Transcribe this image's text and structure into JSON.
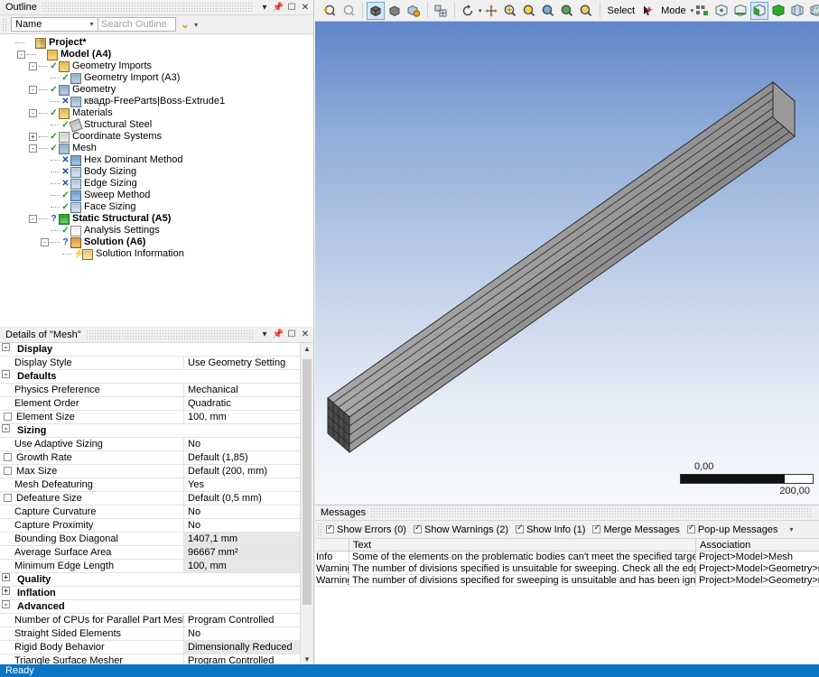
{
  "outline": {
    "title": "Outline",
    "title_buttons": [
      "dropdown-icon",
      "pin-icon",
      "maximize-icon",
      "close-icon"
    ],
    "filter_combo": "Name",
    "search_placeholder": "Search Outline",
    "tree": [
      {
        "label": "Project*",
        "indent": 0,
        "expander": "none",
        "status": "",
        "icon": "project-icon",
        "bold": true
      },
      {
        "label": "Model (A4)",
        "indent": 1,
        "expander": "-",
        "status": "",
        "icon": "model-icon",
        "bold": true
      },
      {
        "label": "Geometry Imports",
        "indent": 2,
        "expander": "-",
        "status": "ok",
        "icon": "geometry-imports-icon",
        "bold": false
      },
      {
        "label": "Geometry Import (A3)",
        "indent": 3,
        "expander": "none",
        "status": "ok",
        "icon": "geometry-import-icon",
        "bold": false
      },
      {
        "label": "Geometry",
        "indent": 2,
        "expander": "-",
        "status": "ok",
        "icon": "geometry-icon",
        "bold": false
      },
      {
        "label": "квадр-FreeParts|Boss-Extrude1",
        "indent": 3,
        "expander": "none",
        "status": "x",
        "icon": "body-icon",
        "bold": false
      },
      {
        "label": "Materials",
        "indent": 2,
        "expander": "-",
        "status": "ok",
        "icon": "materials-icon",
        "bold": false
      },
      {
        "label": "Structural Steel",
        "indent": 3,
        "expander": "none",
        "status": "ok",
        "icon": "material-icon",
        "bold": false
      },
      {
        "label": "Coordinate Systems",
        "indent": 2,
        "expander": "+",
        "status": "ok",
        "icon": "coordinate-systems-icon",
        "bold": false
      },
      {
        "label": "Mesh",
        "indent": 2,
        "expander": "-",
        "status": "ok",
        "icon": "mesh-icon",
        "bold": false
      },
      {
        "label": "Hex Dominant Method",
        "indent": 3,
        "expander": "none",
        "status": "x",
        "icon": "method-icon",
        "bold": false
      },
      {
        "label": "Body Sizing",
        "indent": 3,
        "expander": "none",
        "status": "x",
        "icon": "sizing-icon",
        "bold": false
      },
      {
        "label": "Edge Sizing",
        "indent": 3,
        "expander": "none",
        "status": "x",
        "icon": "sizing-icon",
        "bold": false
      },
      {
        "label": "Sweep Method",
        "indent": 3,
        "expander": "none",
        "status": "ok",
        "icon": "method-icon",
        "bold": false
      },
      {
        "label": "Face Sizing",
        "indent": 3,
        "expander": "none",
        "status": "ok",
        "icon": "sizing-icon",
        "bold": false
      },
      {
        "label": "Static Structural (A5)",
        "indent": 2,
        "expander": "-",
        "status": "q",
        "icon": "static-structural-icon",
        "bold": true
      },
      {
        "label": "Analysis Settings",
        "indent": 3,
        "expander": "none",
        "status": "ok",
        "icon": "analysis-settings-icon",
        "bold": false
      },
      {
        "label": "Solution (A6)",
        "indent": 3,
        "expander": "-",
        "status": "q",
        "icon": "solution-icon",
        "bold": true
      },
      {
        "label": "Solution Information",
        "indent": 4,
        "expander": "none",
        "status": "bolt",
        "icon": "solution-information-icon",
        "bold": false
      }
    ]
  },
  "details": {
    "title": "Details of \"Mesh\"",
    "rows": [
      {
        "type": "group",
        "name": "Display",
        "value": ""
      },
      {
        "type": "row",
        "name": "Display Style",
        "value": "Use Geometry Setting"
      },
      {
        "type": "group",
        "name": "Defaults",
        "value": ""
      },
      {
        "type": "row",
        "name": "Physics Preference",
        "value": "Mechanical"
      },
      {
        "type": "row",
        "name": "Element Order",
        "value": "Quadratic"
      },
      {
        "type": "check",
        "name": "Element Size",
        "value": "100, mm"
      },
      {
        "type": "group",
        "name": "Sizing",
        "value": ""
      },
      {
        "type": "row",
        "name": "Use Adaptive Sizing",
        "value": "No"
      },
      {
        "type": "check",
        "name": "Growth Rate",
        "value": "Default (1,85)"
      },
      {
        "type": "check",
        "name": "Max Size",
        "value": "Default (200, mm)"
      },
      {
        "type": "row",
        "name": "Mesh Defeaturing",
        "value": "Yes"
      },
      {
        "type": "check",
        "name": "Defeature Size",
        "value": "Default (0,5 mm)"
      },
      {
        "type": "row",
        "name": "Capture Curvature",
        "value": "No"
      },
      {
        "type": "row",
        "name": "Capture Proximity",
        "value": "No"
      },
      {
        "type": "row",
        "name": "Bounding Box Diagonal",
        "shade": true,
        "value": "1407,1 mm"
      },
      {
        "type": "row",
        "name": "Average Surface Area",
        "shade": true,
        "value": "96667 mm²"
      },
      {
        "type": "row",
        "name": "Minimum Edge Length",
        "shade": true,
        "value": "100, mm"
      },
      {
        "type": "groupc",
        "name": "Quality",
        "value": ""
      },
      {
        "type": "groupc",
        "name": "Inflation",
        "value": ""
      },
      {
        "type": "group",
        "name": "Advanced",
        "value": ""
      },
      {
        "type": "row",
        "name": "Number of CPUs for Parallel Part Meshing",
        "value": "Program Controlled"
      },
      {
        "type": "row",
        "name": "Straight Sided Elements",
        "value": "No"
      },
      {
        "type": "row",
        "name": "Rigid Body Behavior",
        "shade": true,
        "value": "Dimensionally Reduced"
      },
      {
        "type": "row",
        "name": "Triangle Surface Mesher",
        "value": "Program Controlled"
      }
    ]
  },
  "view_toolbar": {
    "groups": [
      {
        "icons": [
          "zoom-previous-icon",
          "zoom-next-icon"
        ]
      },
      {
        "icons": [
          "shaded-exterior-and-edges-icon",
          "shaded-exterior-icon",
          "wireframe-icon"
        ]
      },
      {
        "icons": [
          "show-mesh-icon"
        ]
      },
      {
        "icons": [
          "rotate-icon",
          "rotate-dropdown-icon",
          "pan-icon",
          "zoom-icon",
          "box-zoom-icon",
          "zoom-to-fit-icon",
          "magnifier-icon",
          "next-view-icon"
        ]
      }
    ],
    "select_label": "Select",
    "mode_label": "Mode",
    "right_icons": [
      "selection-filter-icon",
      "vertex-select-icon",
      "edge-select-icon",
      "face-select-icon",
      "body-select-icon",
      "single-select-icon",
      "box-select-icon",
      "extend-select-icon",
      "coordinate-axes-icon",
      "ruler-icon"
    ]
  },
  "viewport": {
    "scale_min": "0,00",
    "scale_max": "200,00",
    "model": "meshed-rectangular-beam",
    "background_top": "#5f86c9",
    "background_bottom": "#f6f8fb",
    "mesh_divisions_across": 4,
    "mesh_divisions_along": 8
  },
  "messages": {
    "title": "Messages",
    "toolbar": [
      {
        "label": "Show Errors",
        "count": "(0)",
        "checked": true
      },
      {
        "label": "Show Warnings",
        "count": "(2)",
        "checked": true
      },
      {
        "label": "Show Info",
        "count": "(1)",
        "checked": true
      },
      {
        "label": "Merge Messages",
        "count": "",
        "checked": true
      },
      {
        "label": "Pop-up Messages",
        "count": "",
        "checked": true
      }
    ],
    "columns": [
      "",
      "Text",
      "Association"
    ],
    "rows": [
      {
        "severity": "Info",
        "text": "Some of the elements on the problematic bodies can't meet the specified target metrics. F",
        "association": "Project>Model>Mesh"
      },
      {
        "severity": "Warning",
        "text": "The number of divisions specified is unsuitable for sweeping. Check all the edges and fac",
        "association": "Project>Model>Geometry>кв"
      },
      {
        "severity": "Warning",
        "text": "The number of divisions specified for sweeping is unsuitable and has been ignored.",
        "association": "Project>Model>Geometry>кв"
      }
    ]
  },
  "statusbar": {
    "text": "Ready",
    "color": "#0a75c2"
  }
}
